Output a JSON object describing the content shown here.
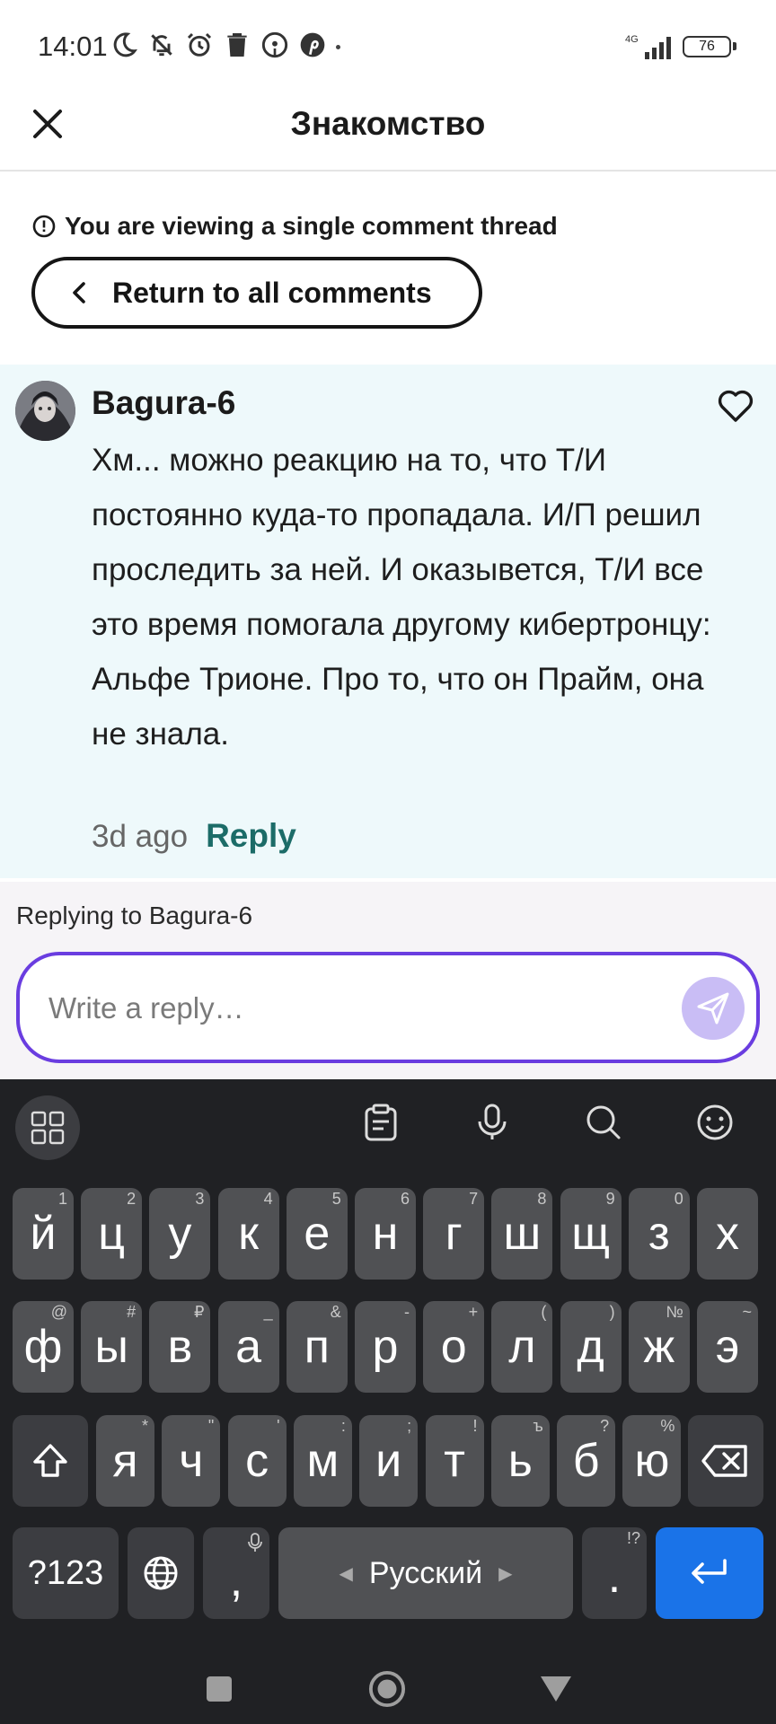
{
  "status_bar": {
    "time": "14:01",
    "network": "4G",
    "battery": "76"
  },
  "header": {
    "title": "Знакомство"
  },
  "thread": {
    "notice": "You are viewing a single comment thread",
    "return_label": "Return to all comments"
  },
  "comment": {
    "author": "Bagura-6",
    "text": "Хм... можно реакцию на то, что Т/И постоянно куда-то пропадала. И/П решил проследить за ней. И оказывется, Т/И все это время помогала другому кибертронцу: Альфе Трионе. Про то, что он Прайм, она не знала.",
    "time_ago": "3d ago",
    "reply_label": "Reply"
  },
  "reply_box": {
    "replying_to": "Replying to Bagura-6",
    "placeholder": "Write a reply…",
    "value": ""
  },
  "keyboard": {
    "row1": [
      {
        "k": "й",
        "h": "1"
      },
      {
        "k": "ц",
        "h": "2"
      },
      {
        "k": "у",
        "h": "3"
      },
      {
        "k": "к",
        "h": "4"
      },
      {
        "k": "е",
        "h": "5"
      },
      {
        "k": "н",
        "h": "6"
      },
      {
        "k": "г",
        "h": "7"
      },
      {
        "k": "ш",
        "h": "8"
      },
      {
        "k": "щ",
        "h": "9"
      },
      {
        "k": "з",
        "h": "0"
      },
      {
        "k": "х",
        "h": ""
      }
    ],
    "row2": [
      {
        "k": "ф",
        "h": "@"
      },
      {
        "k": "ы",
        "h": "#"
      },
      {
        "k": "в",
        "h": "₽"
      },
      {
        "k": "а",
        "h": "_"
      },
      {
        "k": "п",
        "h": "&"
      },
      {
        "k": "р",
        "h": "-"
      },
      {
        "k": "о",
        "h": "+"
      },
      {
        "k": "л",
        "h": "("
      },
      {
        "k": "д",
        "h": ")"
      },
      {
        "k": "ж",
        "h": "№"
      },
      {
        "k": "э",
        "h": "~"
      }
    ],
    "row3": [
      {
        "k": "я",
        "h": "*"
      },
      {
        "k": "ч",
        "h": "\""
      },
      {
        "k": "с",
        "h": "'"
      },
      {
        "k": "м",
        "h": ":"
      },
      {
        "k": "и",
        "h": ";"
      },
      {
        "k": "т",
        "h": "!"
      },
      {
        "k": "ь",
        "h": "ъ"
      },
      {
        "k": "б",
        "h": "?"
      },
      {
        "k": "ю",
        "h": "%"
      }
    ],
    "symbols_key": "?123",
    "comma": ",",
    "space_label": "Русский",
    "period": ".",
    "period_hint": "!?"
  }
}
